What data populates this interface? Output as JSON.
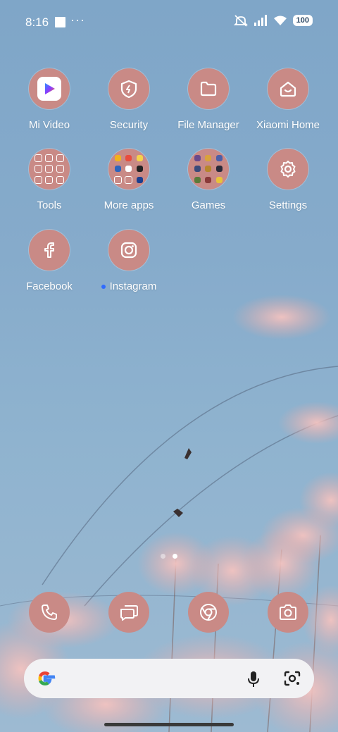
{
  "status": {
    "time": "8:16",
    "battery": "100"
  },
  "apps": [
    {
      "label": "Mi Video",
      "icon": "mi-video-icon"
    },
    {
      "label": "Security",
      "icon": "security-icon"
    },
    {
      "label": "File Manager",
      "icon": "folder-icon"
    },
    {
      "label": "Xiaomi Home",
      "icon": "home-icon"
    },
    {
      "label": "Tools",
      "icon": "tools-folder-icon"
    },
    {
      "label": "More apps",
      "icon": "more-apps-folder-icon"
    },
    {
      "label": "Games",
      "icon": "games-folder-icon"
    },
    {
      "label": "Settings",
      "icon": "gear-icon"
    },
    {
      "label": "Facebook",
      "icon": "facebook-icon"
    },
    {
      "label": "Instagram",
      "icon": "instagram-icon"
    }
  ],
  "dock": [
    "phone-icon",
    "messages-icon",
    "chrome-icon",
    "camera-icon"
  ],
  "colors": {
    "icon_bg": "#c98a86",
    "sky": "#86abcb",
    "search_bg": "#f2f2f4",
    "new_dot": "#2f6bff"
  }
}
